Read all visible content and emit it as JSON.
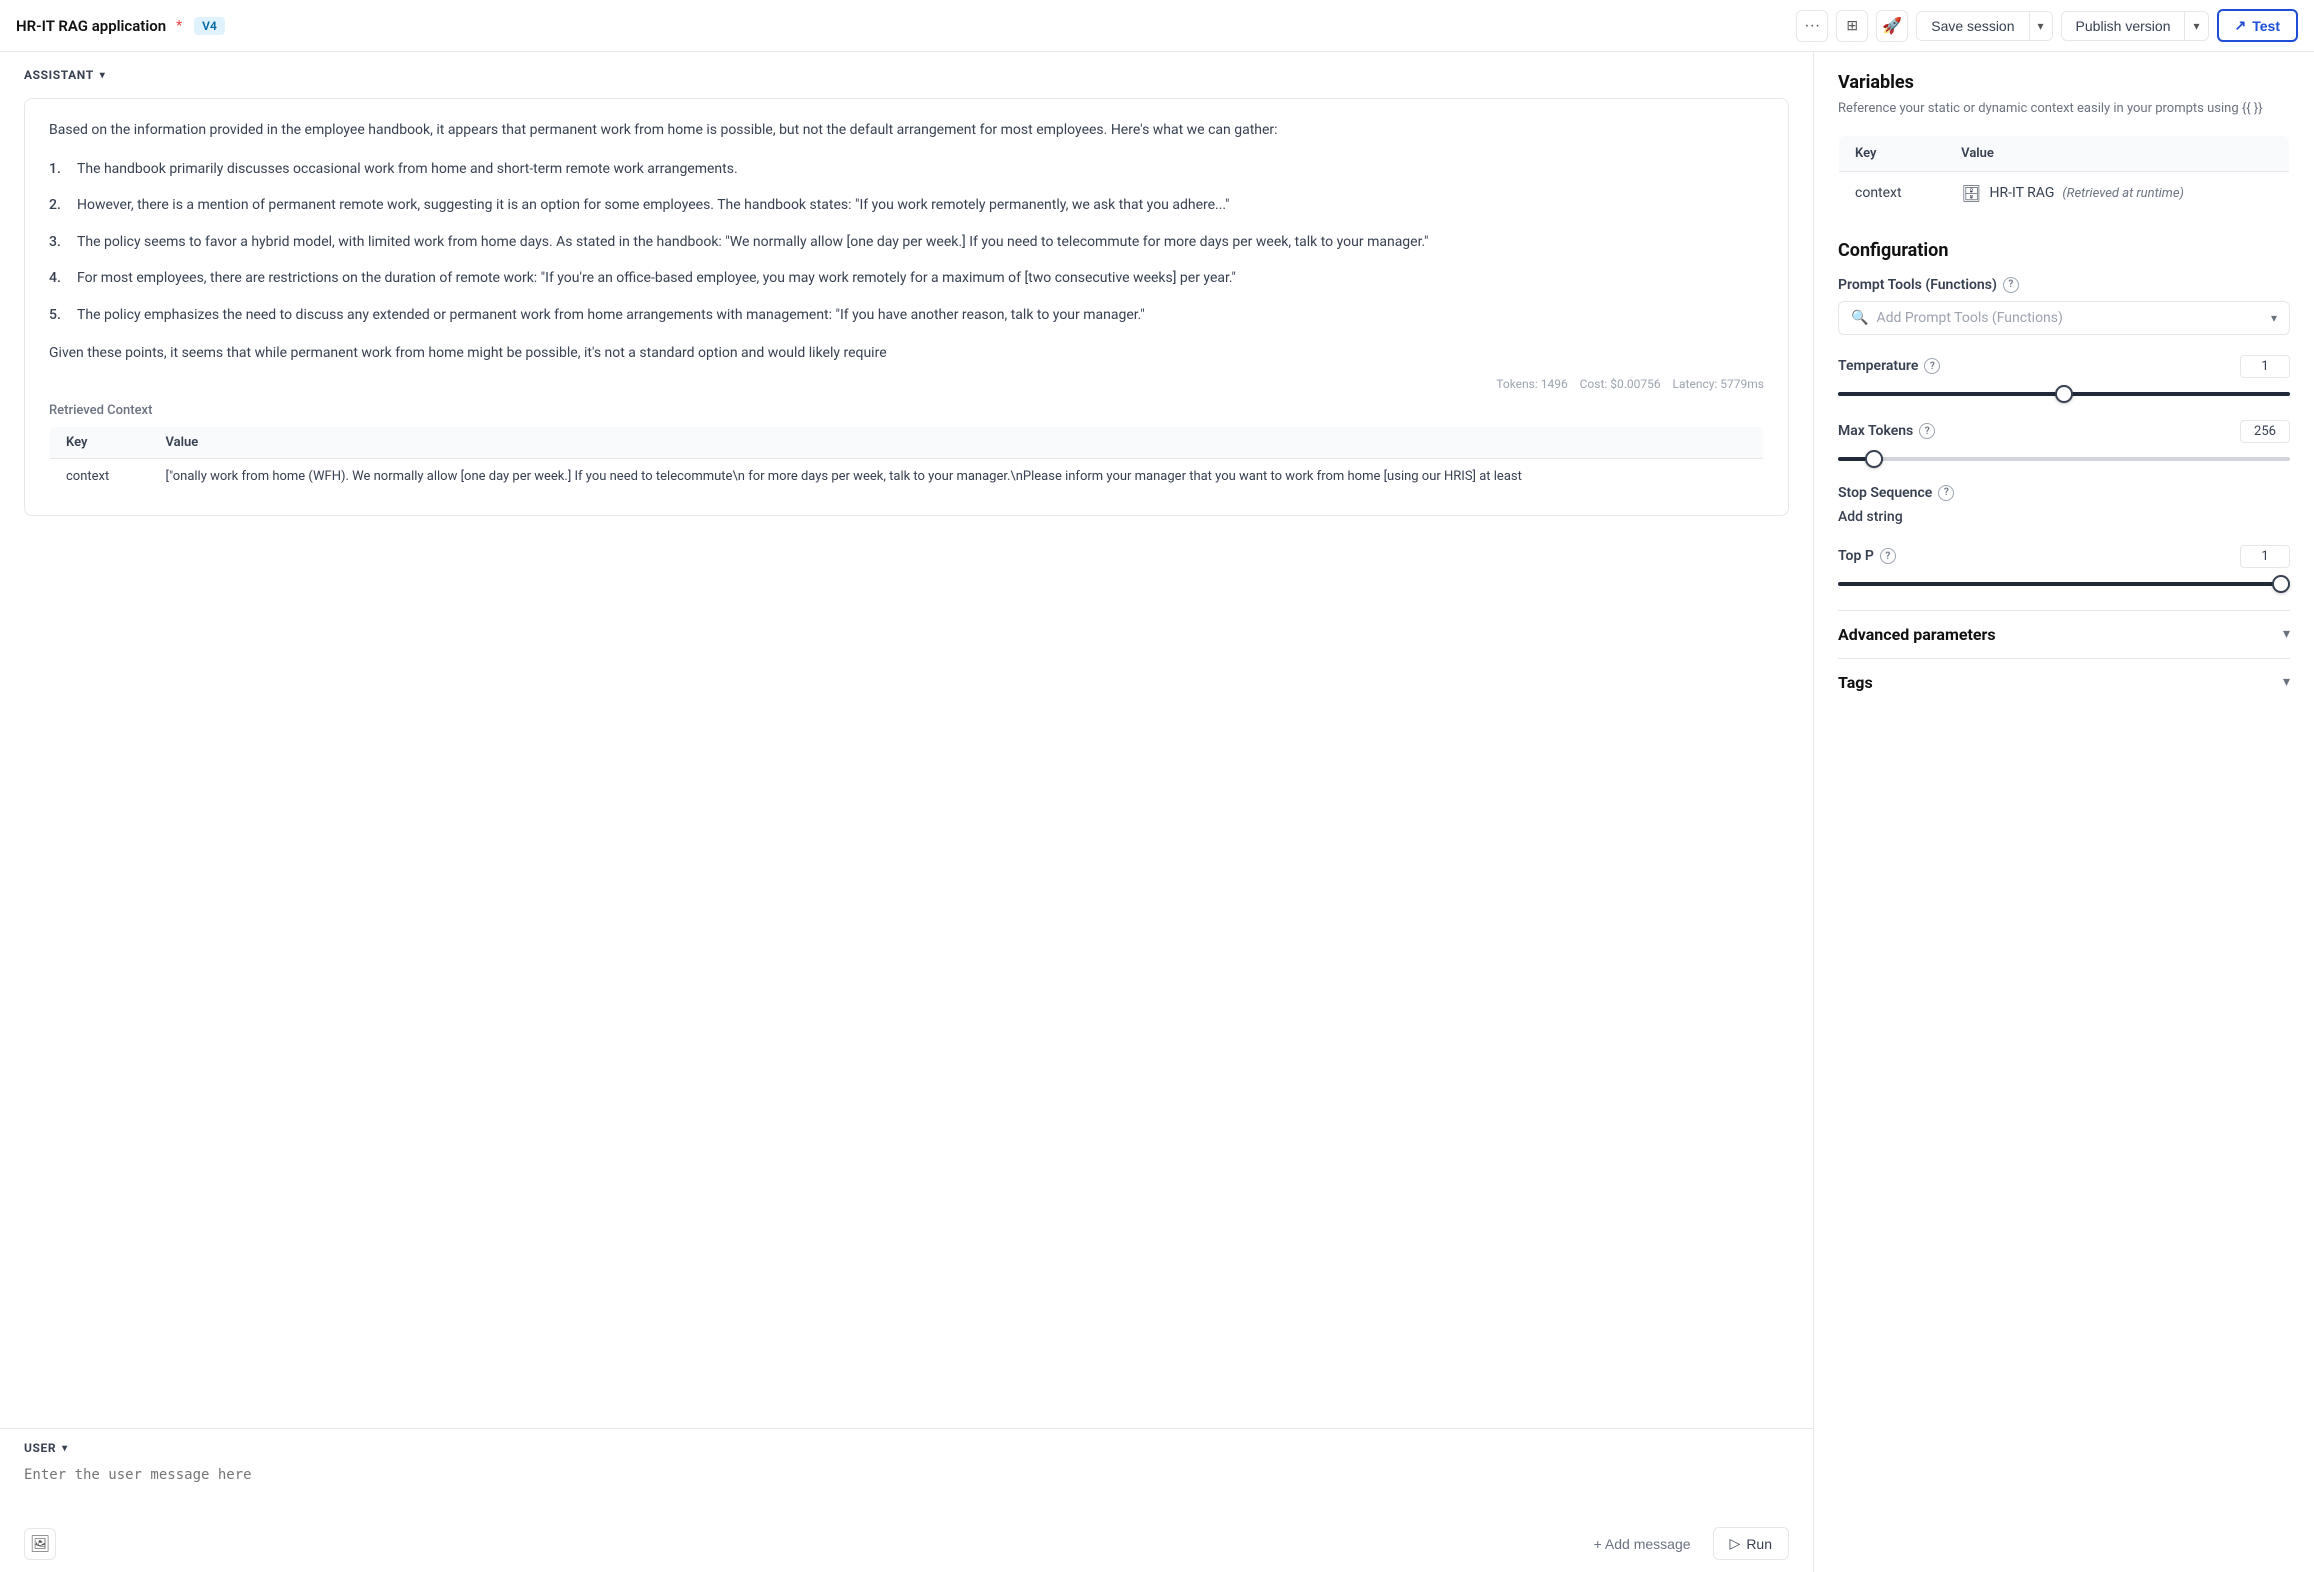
{
  "header": {
    "title": "HR-IT RAG application",
    "star": "*",
    "version_badge": "V4",
    "dots_label": "•••",
    "grid_icon": "grid",
    "rocket_icon": "🚀",
    "save_session_label": "Save session",
    "publish_version_label": "Publish version",
    "test_label": "Test"
  },
  "assistant": {
    "section_label": "ASSISTANT",
    "intro_text": "Based on the information provided in the employee handbook, it appears that permanent work from home is possible, but not the default arrangement for most employees. Here's what we can gather:",
    "list_items": [
      {
        "num": "1.",
        "text": "The handbook primarily discusses occasional work from home and short-term remote work arrangements."
      },
      {
        "num": "2.",
        "text": "However, there is a mention of permanent remote work, suggesting it is an option for some employees. The handbook states: \"If you work remotely permanently, we ask that you adhere...\""
      },
      {
        "num": "3.",
        "text": "The policy seems to favor a hybrid model, with limited work from home days. As stated in the handbook: \"We normally allow [one day per week.] If you need to telecommute for more days per week, talk to your manager.\""
      },
      {
        "num": "4.",
        "text": "For most employees, there are restrictions on the duration of remote work: \"If you're an office-based employee, you may work remotely for a maximum of [two consecutive weeks] per year.\""
      },
      {
        "num": "5.",
        "text": "The policy emphasizes the need to discuss any extended or permanent work from home arrangements with management: \"If you have another reason, talk to your manager.\""
      }
    ],
    "conclusion_text": "Given these points, it seems that while permanent work from home might be possible, it's not a standard option and would likely require",
    "tokens_text": "Tokens: 1496",
    "cost_text": "Cost: $0.00756",
    "latency_text": "Latency: 5779ms"
  },
  "retrieved_context": {
    "label": "Retrieved Context",
    "table": {
      "headers": [
        "Key",
        "Value"
      ],
      "rows": [
        {
          "key": "context",
          "value": "[\"onally work from home (WFH). We normally allow [one day per week.] If you need to telecommute\\n for more days per week, talk to your manager.\\nPlease inform your manager that you want to work from home [using our HRIS] at least"
        }
      ]
    }
  },
  "user": {
    "section_label": "USER",
    "input_placeholder": "Enter the user message here",
    "add_message_label": "+ Add message",
    "run_label": "▷ Run"
  },
  "variables": {
    "title": "Variables",
    "subtitle": "Reference your static or dynamic context easily in your prompts using {{ }}",
    "table": {
      "headers": [
        "Key",
        "Value"
      ],
      "rows": [
        {
          "key": "context",
          "value": "HR-IT RAG",
          "runtime": "(Retrieved at runtime)"
        }
      ]
    }
  },
  "configuration": {
    "title": "Configuration",
    "prompt_tools": {
      "label": "Prompt Tools (Functions)",
      "placeholder": "Add Prompt Tools (Functions)"
    },
    "temperature": {
      "label": "Temperature",
      "value": "1"
    },
    "max_tokens": {
      "label": "Max Tokens",
      "value": "256"
    },
    "stop_sequence": {
      "label": "Stop Sequence",
      "add_string_label": "Add string"
    },
    "top_p": {
      "label": "Top P",
      "value": "1"
    },
    "advanced_parameters": {
      "label": "Advanced parameters"
    },
    "tags": {
      "label": "Tags"
    }
  }
}
